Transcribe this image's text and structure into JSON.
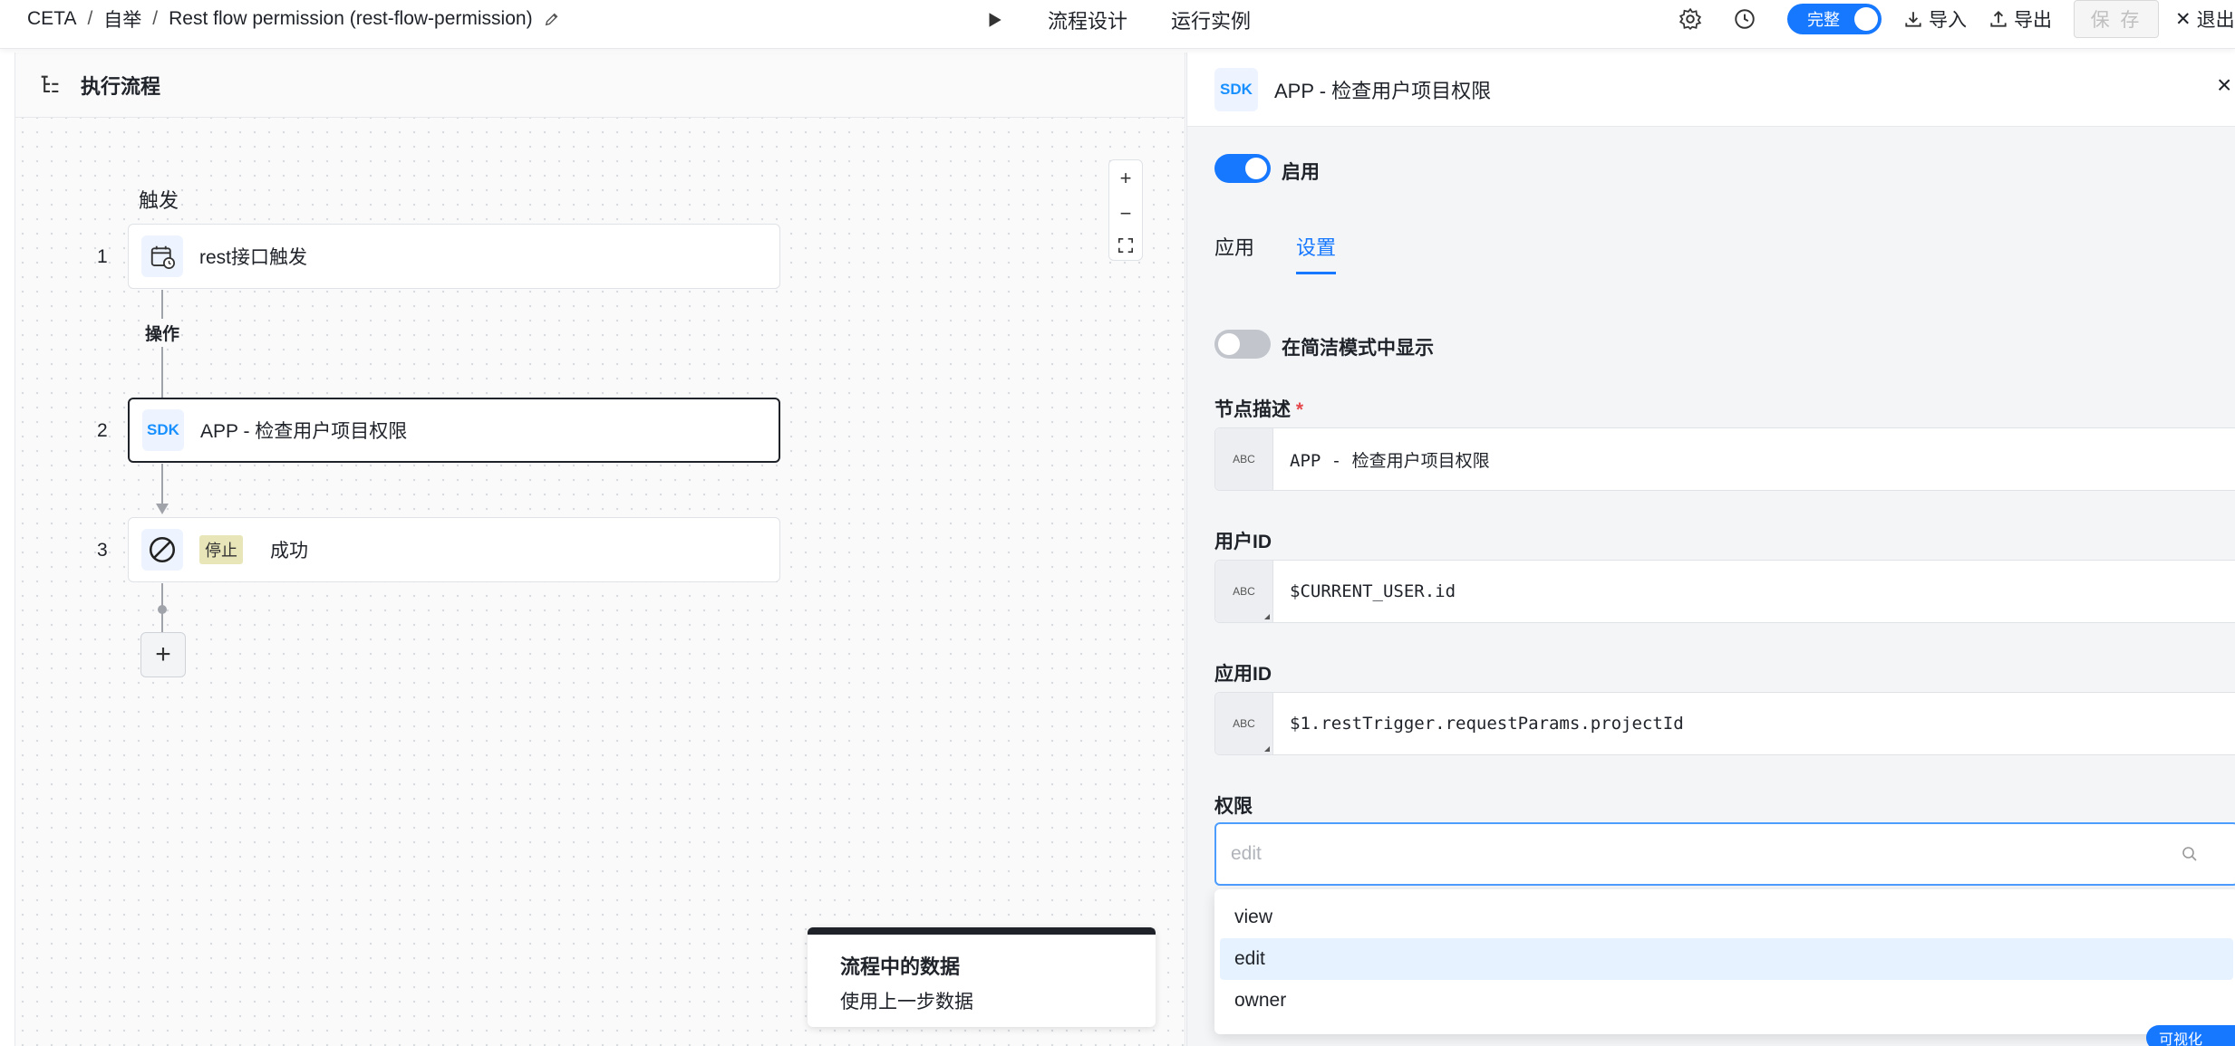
{
  "topbar": {
    "breadcrumb": [
      "CETA",
      "自举",
      "Rest flow permission (rest-flow-permission)"
    ],
    "breadcrumb_sep": "/",
    "nav": [
      "流程设计",
      "运行实例"
    ],
    "mode_label": "完整",
    "import_label": "导入",
    "export_label": "导出",
    "save_label": "保 存",
    "exit_label": "退出"
  },
  "canvas": {
    "header_title": "执行流程",
    "trigger_title": "触发",
    "operation_label": "操作",
    "nodes": [
      {
        "num": "1",
        "label": "rest接口触发"
      },
      {
        "num": "2",
        "icon_text": "SDK",
        "label": "APP - 检查用户项目权限"
      },
      {
        "num": "3",
        "tag": "停止",
        "label": "成功"
      }
    ],
    "zoom": {
      "in": "+",
      "out": "−"
    },
    "add_label": "+",
    "data_card": {
      "title": "流程中的数据",
      "subtitle": "使用上一步数据"
    }
  },
  "panel": {
    "icon_text": "SDK",
    "title": "APP - 检查用户项目权限",
    "close": "×",
    "enabled_label": "启用",
    "tabs": [
      "应用",
      "设置"
    ],
    "simple_mode_label": "在简洁模式中显示",
    "fields": [
      {
        "label": "节点描述",
        "required": "*",
        "type_badge": "ABC",
        "value": "APP - 检查用户项目权限"
      },
      {
        "label": "用户ID",
        "type_badge": "ABC",
        "value": "$CURRENT_USER.id"
      },
      {
        "label": "应用ID",
        "type_badge": "ABC",
        "value": "$1.restTrigger.requestParams.projectId"
      }
    ],
    "permission_label": "权限",
    "permission_placeholder": "edit",
    "permission_options": [
      "view",
      "edit",
      "owner"
    ]
  },
  "bottom_badge": "可视化",
  "colors": {
    "accent": "#1677ff",
    "stop_tag": "#e8e6b8",
    "sdk": "#1890ff"
  }
}
